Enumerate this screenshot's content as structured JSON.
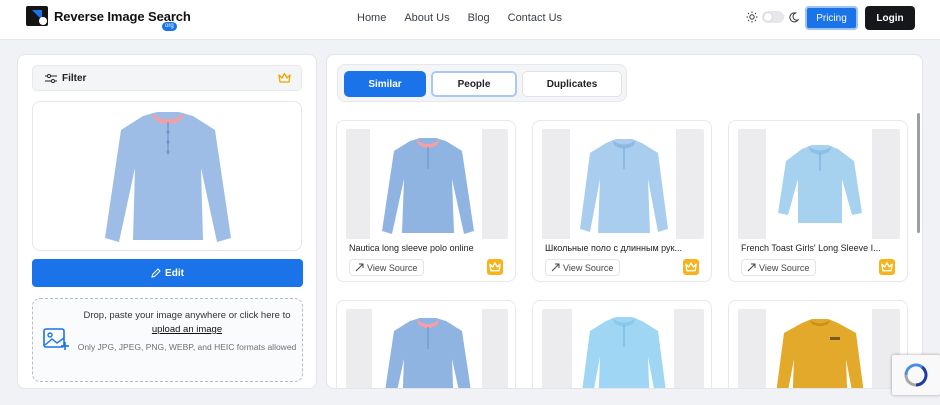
{
  "header": {
    "brand": "Reverse Image Search",
    "badge": "org",
    "nav": [
      "Home",
      "About Us",
      "Blog",
      "Contact Us"
    ],
    "pricing_label": "Pricing",
    "login_label": "Login"
  },
  "left": {
    "filter_label": "Filter",
    "edit_label": "Edit",
    "drop_text": "Drop, paste your image anywhere or click here to",
    "drop_link": "upload an image",
    "formats_text": "Only JPG, JPEG, PNG, WEBP, and HEIC formats allowed"
  },
  "tabs": [
    "Similar",
    "People",
    "Duplicates"
  ],
  "results": [
    {
      "title": "Nautica long sleeve polo online",
      "view_source": "View Source",
      "color": "#8fb4e2"
    },
    {
      "title": "Школьные поло с длинным рук...",
      "view_source": "View Source",
      "color": "#a9cdee"
    },
    {
      "title": "French Toast Girls' Long Sleeve I...",
      "view_source": "View Source",
      "color": "#a6d2f0"
    },
    {
      "title": "",
      "view_source": "",
      "color": "#8fb4e2"
    },
    {
      "title": "",
      "view_source": "",
      "color": "#9fd6f4"
    },
    {
      "title": "",
      "view_source": "",
      "color": "#e3a92a"
    }
  ],
  "colors": {
    "accent": "#1a73e8",
    "crown": "#f6b31c",
    "shirt_preview": "#9dbde6",
    "collar_trim": "#f2a0a8"
  },
  "icons": {
    "logo": "logo-icon",
    "sun": "sun-icon",
    "moon": "moon-icon",
    "filter": "sliders-icon",
    "crown": "crown-icon",
    "edit": "pencil-icon",
    "upload": "image-upload-icon",
    "external": "external-link-icon",
    "recaptcha": "recaptcha-icon"
  }
}
